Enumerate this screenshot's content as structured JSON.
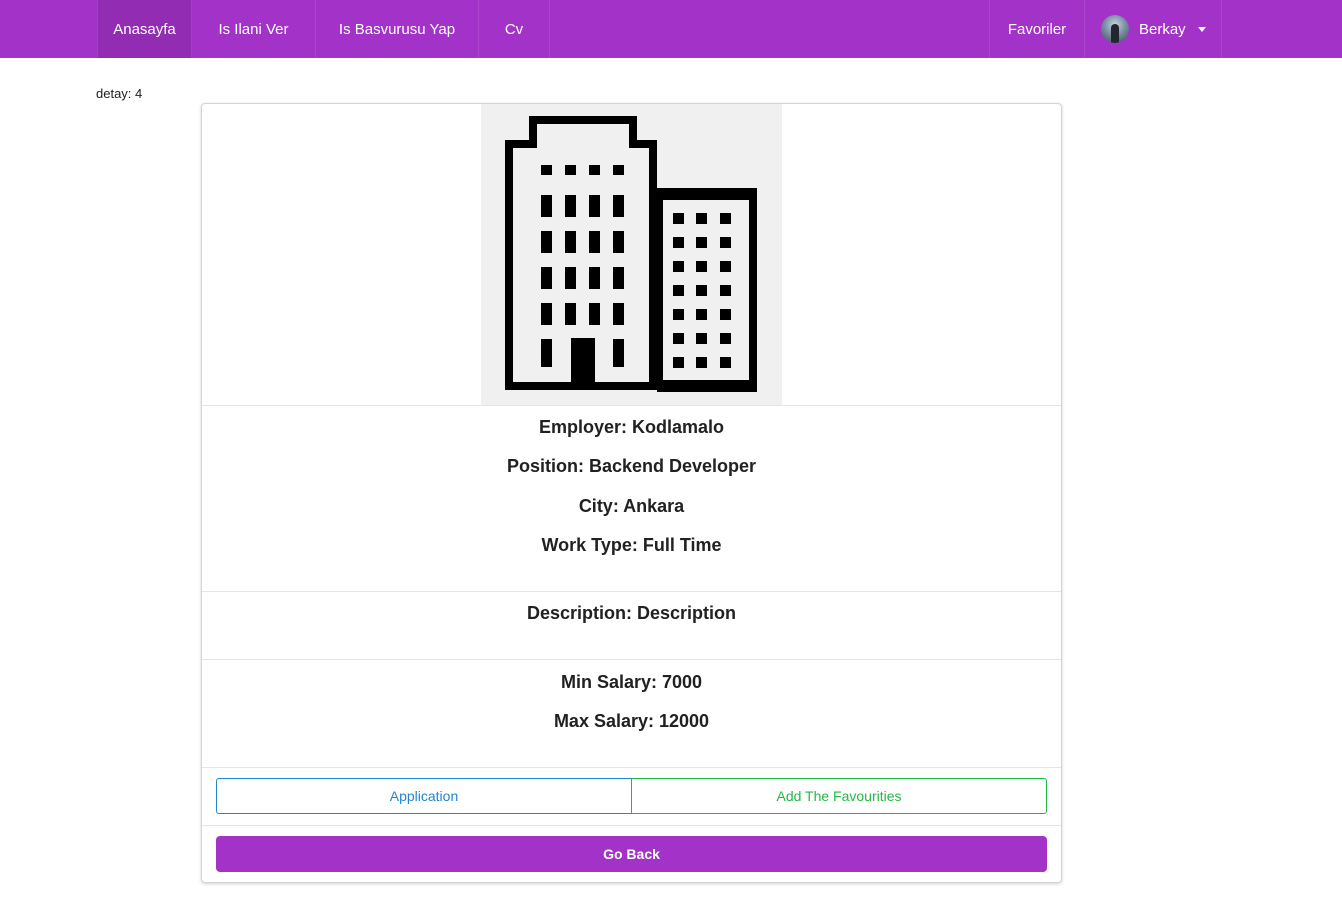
{
  "nav": {
    "items": [
      {
        "label": "Anasayfa",
        "active": true
      },
      {
        "label": "Is Ilani Ver",
        "active": false
      },
      {
        "label": "Is Basvurusu Yap",
        "active": false
      },
      {
        "label": "Cv",
        "active": false
      }
    ],
    "favorites_label": "Favoriler",
    "user": {
      "name": "Berkay"
    }
  },
  "page": {
    "detail_label": "detay: 4"
  },
  "job": {
    "image_icon": "office-building-icon",
    "employer": "Employer: Kodlamalo",
    "position": "Position: Backend Developer",
    "city": "City: Ankara",
    "work_type": "Work Type: Full Time",
    "description": "Description: Description",
    "min_salary": "Min Salary: 7000",
    "max_salary": "Max Salary: 12000"
  },
  "actions": {
    "application_label": "Application",
    "favourite_label": "Add The Favourities",
    "go_back_label": "Go Back"
  },
  "colors": {
    "brand": "#a333c8",
    "primary": "#2185d0",
    "positive": "#21ba45"
  }
}
